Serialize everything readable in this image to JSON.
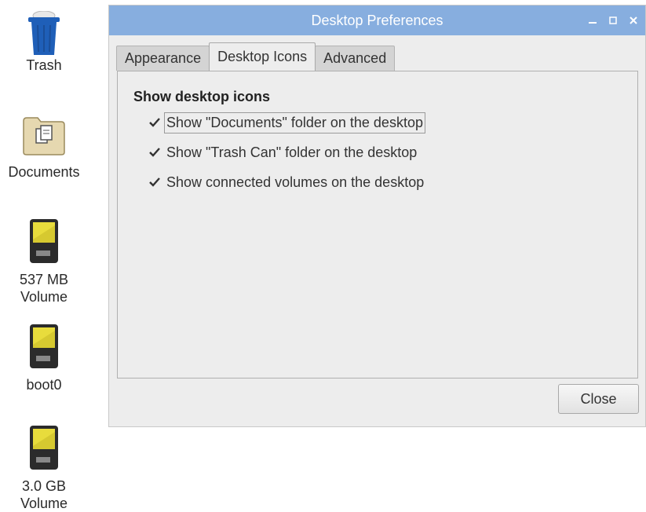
{
  "desktop": {
    "icons": [
      {
        "label": "Trash",
        "icon": "trash-can-icon"
      },
      {
        "label": "Documents",
        "icon": "documents-folder-icon"
      },
      {
        "label": "537 MB\nVolume",
        "icon": "sd-card-volume-icon"
      },
      {
        "label": "boot0",
        "icon": "sd-card-volume-icon"
      },
      {
        "label": "3.0 GB\nVolume",
        "icon": "sd-card-volume-icon"
      }
    ]
  },
  "window": {
    "title": "Desktop Preferences",
    "controls": {
      "minimize": "minimize-icon",
      "maximize": "maximize-icon",
      "close": "close-icon"
    },
    "tabs": [
      {
        "label": "Appearance"
      },
      {
        "label": "Desktop Icons"
      },
      {
        "label": "Advanced"
      }
    ],
    "active_tab": "Desktop Icons",
    "section_title": "Show desktop icons",
    "options": [
      {
        "label": "Show \"Documents\" folder on the desktop",
        "checked": true
      },
      {
        "label": "Show \"Trash Can\" folder on the desktop",
        "checked": true
      },
      {
        "label": "Show connected volumes on the desktop",
        "checked": true
      }
    ],
    "close_label": "Close"
  },
  "colors": {
    "titlebar": "#87aedf",
    "window_bg": "#ededed",
    "trash_blue": "#1f5fb8",
    "card_yellow": "#e8dc3c"
  }
}
